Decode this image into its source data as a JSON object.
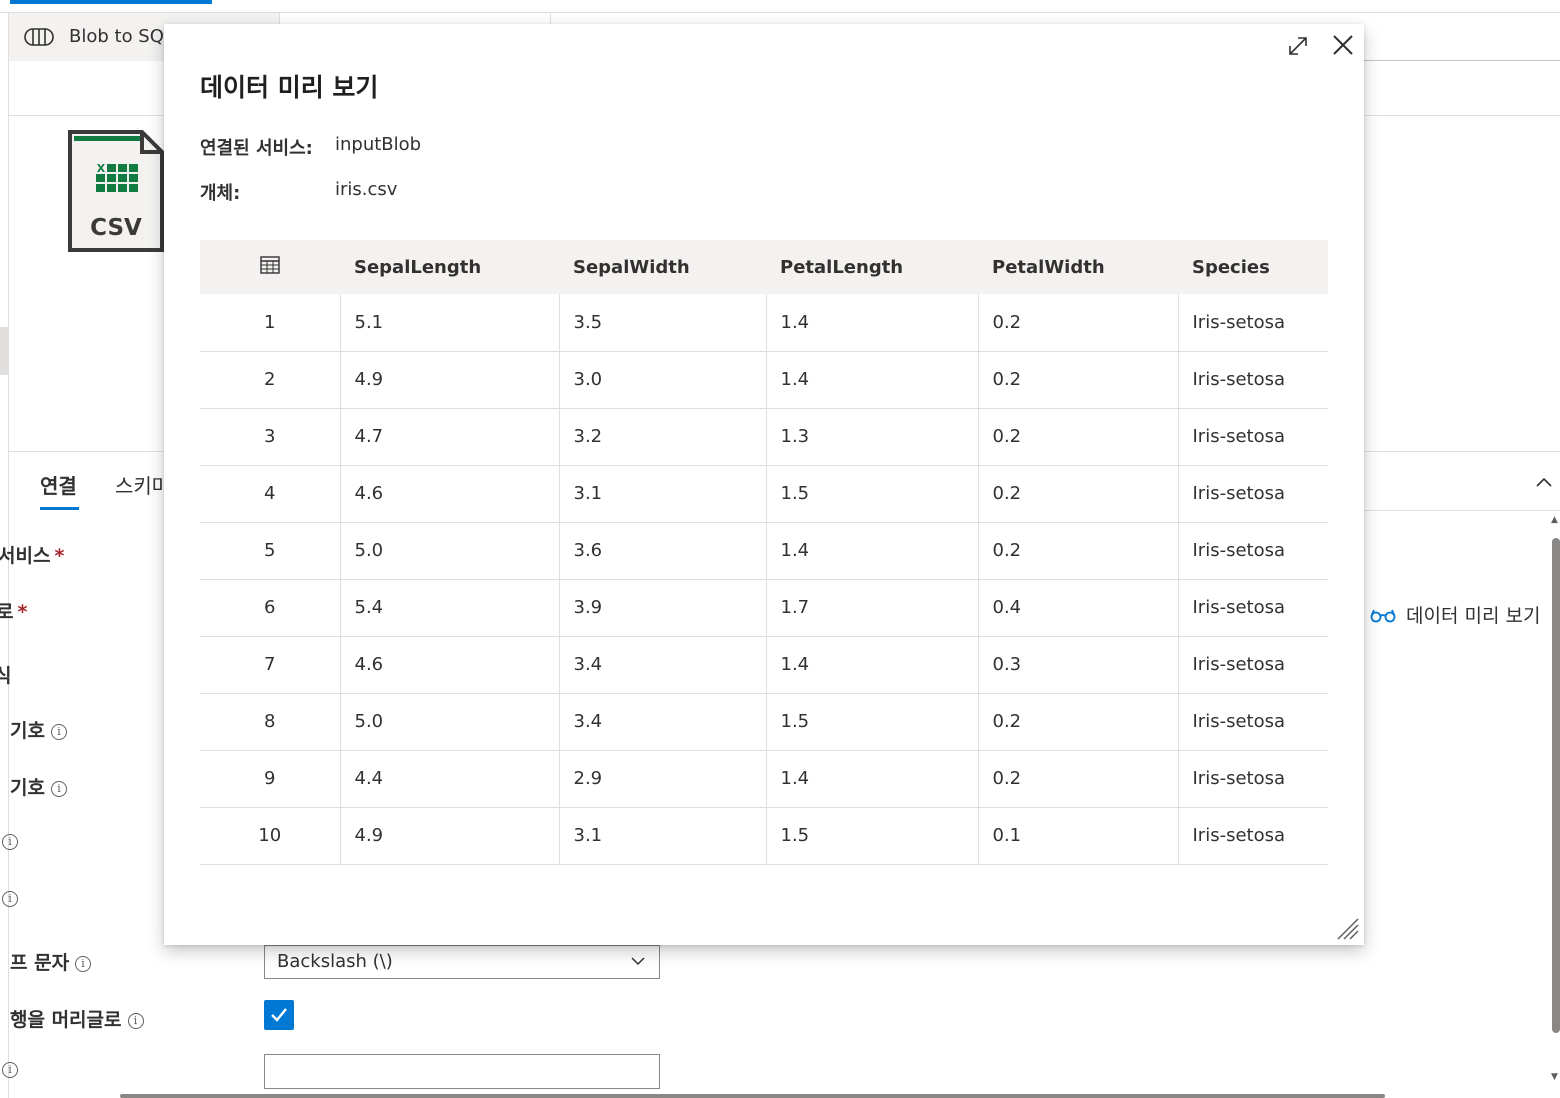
{
  "app": {
    "tab_title": "Blob to SQL",
    "property_tabs": [
      "연결",
      "스키마"
    ],
    "fields": [
      {
        "label": "서비스",
        "required": true,
        "info": false
      },
      {
        "label": "로",
        "required": true,
        "info": false
      },
      {
        "label": "식",
        "required": false,
        "info": false
      },
      {
        "label": "기호",
        "required": false,
        "info": true
      },
      {
        "label": "기호",
        "required": false,
        "info": true
      },
      {
        "label": "",
        "required": false,
        "info": true
      },
      {
        "label": "",
        "required": false,
        "info": true
      },
      {
        "label": "프 문자",
        "required": false,
        "info": true
      },
      {
        "label": "행을 머리글로",
        "required": false,
        "info": true
      },
      {
        "label": "",
        "required": false,
        "info": true
      }
    ],
    "data_preview_link": "데이터 미리 보기",
    "escape_char_value": "Backslash (\\)",
    "first_row_header_checked": true,
    "null_value_input": ""
  },
  "csv_icon_label": "CSV",
  "modal": {
    "title": "데이터 미리 보기",
    "linked_service_label": "연결된 서비스:",
    "linked_service_value": "inputBlob",
    "object_label": "개체:",
    "object_value": "iris.csv",
    "columns": [
      "SepalLength",
      "SepalWidth",
      "PetalLength",
      "PetalWidth",
      "Species"
    ],
    "rows": [
      [
        "1",
        "5.1",
        "3.5",
        "1.4",
        "0.2",
        "Iris-setosa"
      ],
      [
        "2",
        "4.9",
        "3.0",
        "1.4",
        "0.2",
        "Iris-setosa"
      ],
      [
        "3",
        "4.7",
        "3.2",
        "1.3",
        "0.2",
        "Iris-setosa"
      ],
      [
        "4",
        "4.6",
        "3.1",
        "1.5",
        "0.2",
        "Iris-setosa"
      ],
      [
        "5",
        "5.0",
        "3.6",
        "1.4",
        "0.2",
        "Iris-setosa"
      ],
      [
        "6",
        "5.4",
        "3.9",
        "1.7",
        "0.4",
        "Iris-setosa"
      ],
      [
        "7",
        "4.6",
        "3.4",
        "1.4",
        "0.3",
        "Iris-setosa"
      ],
      [
        "8",
        "5.0",
        "3.4",
        "1.5",
        "0.2",
        "Iris-setosa"
      ],
      [
        "9",
        "4.4",
        "2.9",
        "1.4",
        "0.2",
        "Iris-setosa"
      ],
      [
        "10",
        "4.9",
        "3.1",
        "1.5",
        "0.1",
        "Iris-setosa"
      ]
    ]
  },
  "colors": {
    "accent": "#0078d4",
    "required": "#a4262c",
    "header_bg": "#f3f2f1",
    "csv_green": "#107c41",
    "icon_dark": "#3b3a39"
  }
}
